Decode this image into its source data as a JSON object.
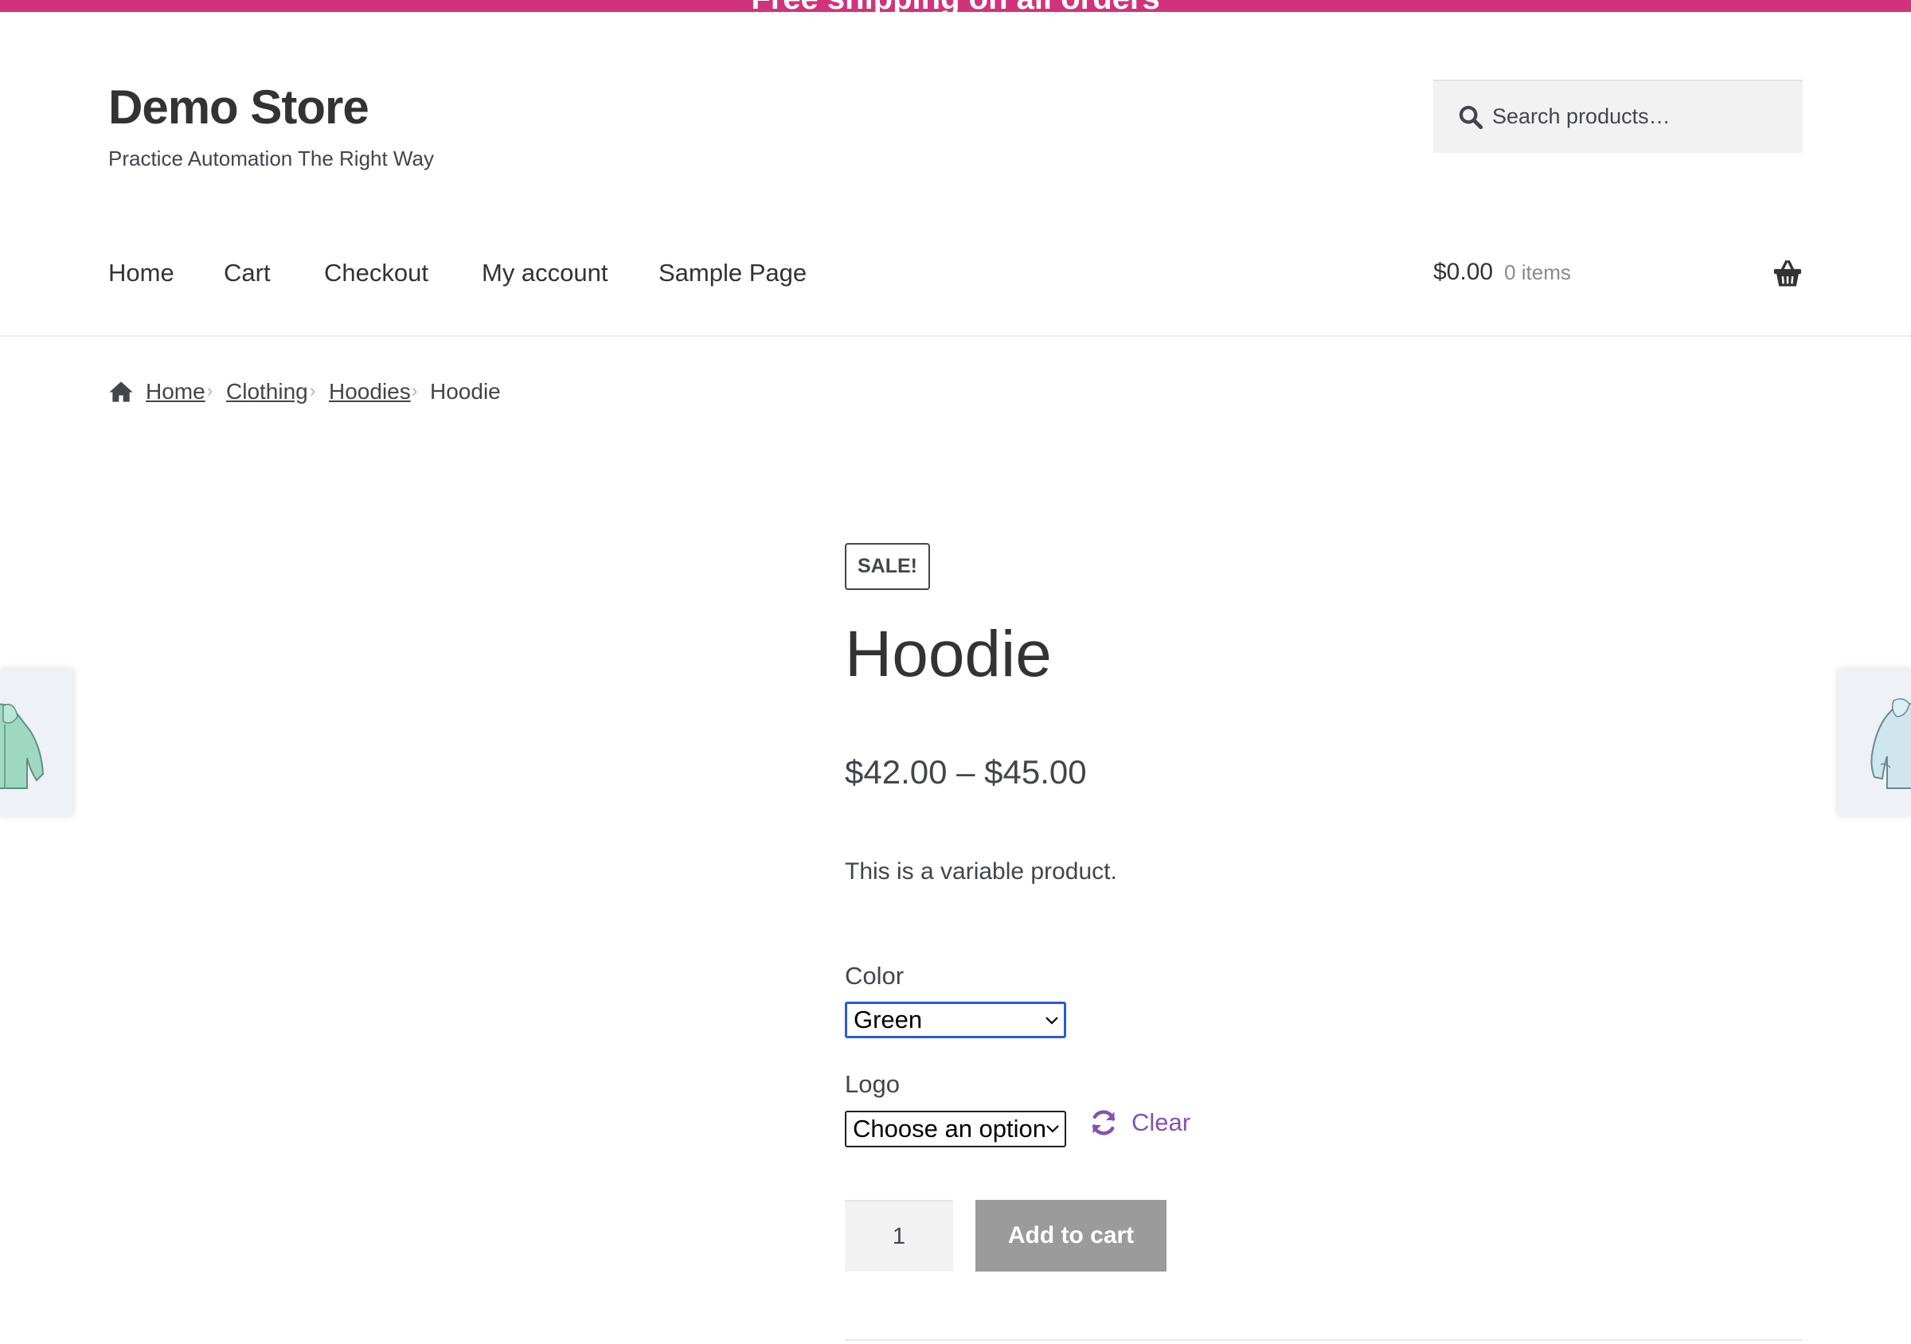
{
  "notice_bar": {
    "text": "Free shipping on all orders",
    "color": "#d1337a"
  },
  "site": {
    "title": "Demo Store",
    "tagline": "Practice Automation The Right Way"
  },
  "search": {
    "placeholder": "Search products…",
    "icon": "search-icon"
  },
  "nav": {
    "items": [
      "Home",
      "Cart",
      "Checkout",
      "My account",
      "Sample Page"
    ]
  },
  "cart": {
    "amount": "$0.00",
    "count": "0 items",
    "icon": "basket-icon"
  },
  "breadcrumb": {
    "home": "Home",
    "category": "Clothing",
    "subcategory": "Hoodies",
    "current": "Hoodie",
    "separator": "›"
  },
  "product": {
    "badge": "SALE!",
    "title": "Hoodie",
    "price": "$42.00 – $45.00",
    "short_description": "This is a variable product.",
    "variations": {
      "color": {
        "label": "Color",
        "value": "Green"
      },
      "logo": {
        "label": "Logo",
        "value": "Choose an option"
      }
    },
    "clear_label": "Clear",
    "quantity": "1",
    "add_to_cart_label": "Add to cart"
  },
  "colors": {
    "accent": "#d1337a",
    "link_purple": "#7f54b3",
    "button_disabled": "#9b9b9b",
    "focus_blue": "#2b5ccf"
  }
}
